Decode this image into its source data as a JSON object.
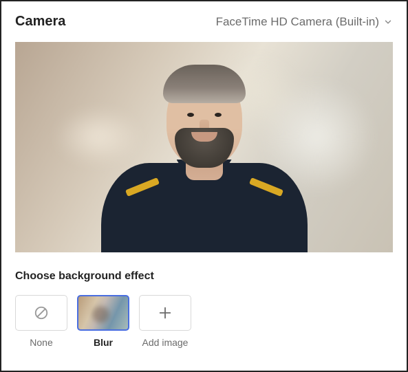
{
  "header": {
    "title": "Camera",
    "camera_selected": "FaceTime HD Camera (Built-in)"
  },
  "section": {
    "background_effect_title": "Choose background effect"
  },
  "effects": {
    "none": {
      "label": "None",
      "icon": "none-icon"
    },
    "blur": {
      "label": "Blur",
      "icon": "blur-preview",
      "selected": true
    },
    "add_image": {
      "label": "Add image",
      "icon": "plus-icon"
    }
  }
}
